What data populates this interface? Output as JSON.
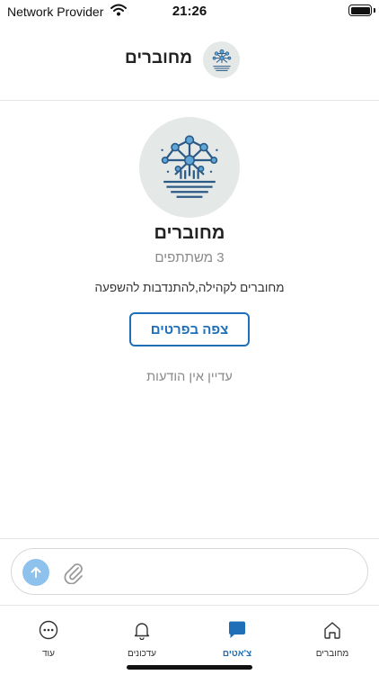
{
  "status_bar": {
    "carrier": "Network Provider",
    "time": "21:26"
  },
  "header": {
    "title": "מחוברים"
  },
  "group": {
    "name": "מחוברים",
    "participants": "3 משתתפים",
    "description": "מחוברים לקהילה,להתנדבות להשפעה",
    "details_button": "צפה בפרטים",
    "empty_state": "עדיין אין הודעות"
  },
  "composer": {
    "placeholder": ""
  },
  "tabs": [
    {
      "label": "עוד",
      "icon": "more-icon"
    },
    {
      "label": "עדכונים",
      "icon": "bell-icon"
    },
    {
      "label": "צ'אטים",
      "icon": "chat-icon",
      "active": true
    },
    {
      "label": "מחוברים",
      "icon": "home-icon"
    }
  ],
  "colors": {
    "accent": "#1e6fb8",
    "send_button": "#8ec1ec",
    "muted_text": "#8a8a8a"
  }
}
